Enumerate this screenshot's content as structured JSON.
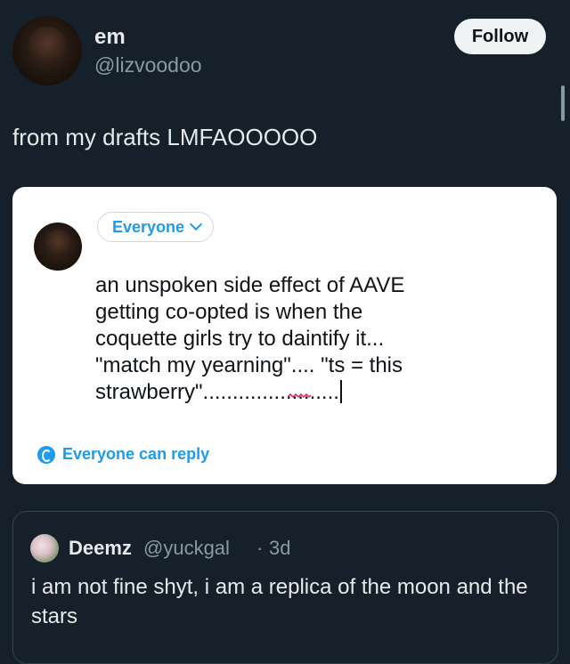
{
  "tweet": {
    "author": {
      "display_name": "em",
      "handle": "@lizvoodoo"
    },
    "follow_label": "Follow",
    "text": "from my drafts LMFAOOOOO"
  },
  "draft_card": {
    "audience_label": "Everyone",
    "draft_text": "an unspoken side effect of AAVE\ngetting co-opted is when the\ncoquette girls try to daintify it...\n\"match my yearning\".... \"ts = this\nstrawberry\".......................",
    "reply_setting_label": "Everyone can reply",
    "colors": {
      "accent": "#1d9bf0"
    }
  },
  "quote": {
    "name": "Deemz",
    "handle": "@yuckgal",
    "separator": "·",
    "time": "3d",
    "text": "i am not fine shyt, i am a replica of the moon and the stars"
  },
  "colors": {
    "background": "#15202b",
    "text_primary": "#e7e9ea",
    "text_secondary": "#8b98a5"
  }
}
